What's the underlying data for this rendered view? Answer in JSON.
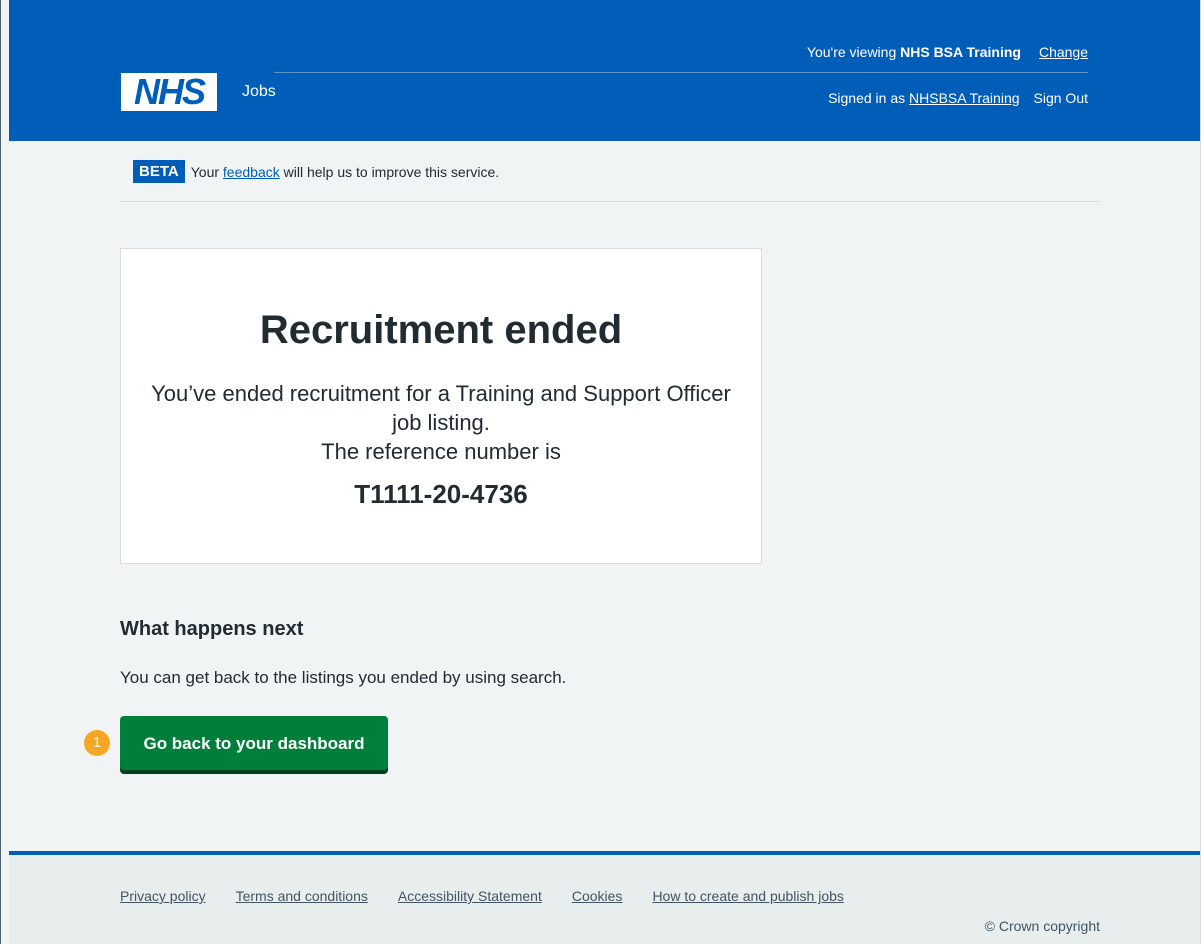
{
  "header": {
    "viewing_prefix": "You're viewing",
    "viewing_org": "NHS BSA Training",
    "change_link": "Change",
    "signed_in_prefix": "Signed in as",
    "signed_in_user": "NHSBSA Training",
    "sign_out": "Sign Out",
    "logo_text": "NHS",
    "service_name": "Jobs"
  },
  "beta_banner": {
    "tag": "BETA",
    "text_before": "Your",
    "link": "feedback",
    "text_after": "will help us to improve this service."
  },
  "confirmation": {
    "title": "Recruitment ended",
    "body_line1": "You’ve ended recruitment for a Training and Support Officer job listing.",
    "body_line2": "The reference number is",
    "reference": "T1111-20-4736"
  },
  "next_steps": {
    "heading": "What happens next",
    "text": "You can get back to the listings you ended by using search.",
    "button": "Go back to your dashboard",
    "marker": "1"
  },
  "footer": {
    "links": [
      "Privacy policy",
      "Terms and conditions",
      "Accessibility Statement",
      "Cookies",
      "How to create and publish jobs"
    ],
    "copyright": "© Crown copyright"
  },
  "colors": {
    "brand_blue": "#005eb8",
    "button_green": "#007f3b",
    "marker_orange": "#f5a623",
    "page_bg": "#f0f4f5"
  }
}
